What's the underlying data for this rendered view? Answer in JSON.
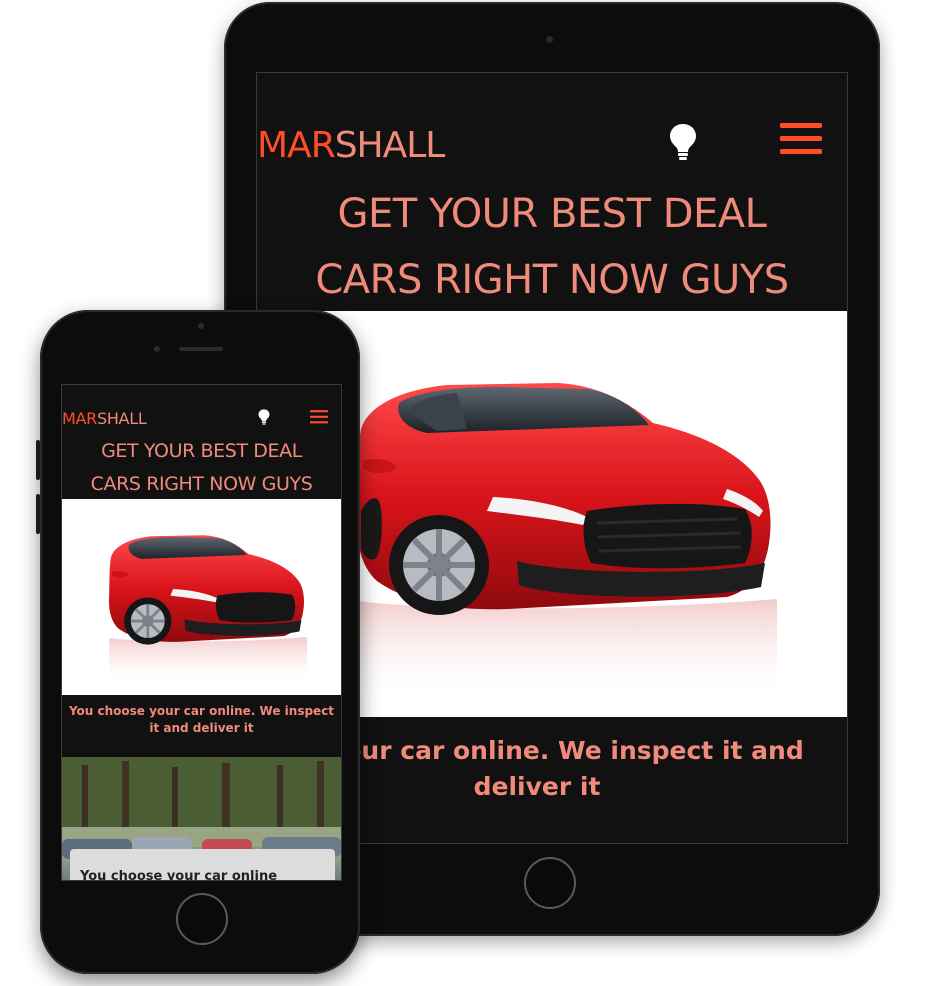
{
  "brand": {
    "part1": "MAR",
    "part2": "SHALL"
  },
  "headline": {
    "line1": "GET YOUR BEST DEAL",
    "line2": "CARS RIGHT NOW GUYS"
  },
  "caption": {
    "tablet_line1": "ose your car online. We inspect it and",
    "tablet_line2": "deliver it",
    "phone_text": "You choose your car online. We inspect it and deliver it"
  },
  "card": {
    "text": "You choose your car online"
  },
  "icons": {
    "theme": "lightbulb-icon",
    "menu": "hamburger-menu-icon"
  },
  "colors": {
    "brand": "#ff4d29",
    "accent": "#f08a7b",
    "background": "#111111"
  }
}
